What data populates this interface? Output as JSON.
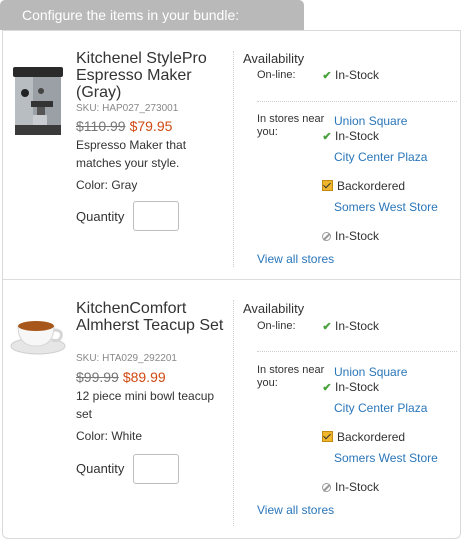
{
  "header": {
    "title": "Configure the items in your bundle:"
  },
  "labels": {
    "quantity": "Quantity",
    "availability": "Availability",
    "online": "On-line:",
    "in_stores": "In stores near you:",
    "view_all": "View all stores"
  },
  "items": [
    {
      "title": "Kitchenel StylePro Espresso Maker (Gray)",
      "sku": "SKU: HAP027_273001",
      "price_old": "$110.99",
      "price_new": "$79.95",
      "desc": "Espresso Maker that matches your style.",
      "color": "Color: Gray",
      "image_icon": "espresso-maker-image",
      "online_status": "In-Stock",
      "stores": [
        {
          "name": "Union Square",
          "status": "In-Stock",
          "icon": "check-icon"
        },
        {
          "name": "City Center Plaza",
          "status": "Backordered",
          "icon": "backorder-icon"
        },
        {
          "name": "Somers West Store",
          "status": "In-Stock",
          "icon": "unavailable-icon"
        }
      ]
    },
    {
      "title": "KitchenComfort Almherst Teacup Set",
      "sku": "SKU: HTA029_292201",
      "price_old": "$99.99",
      "price_new": "$89.99",
      "desc": "12 piece mini bowl teacup set",
      "color": "Color: White",
      "image_icon": "teacup-image",
      "online_status": "In-Stock",
      "stores": [
        {
          "name": "Union Square",
          "status": "In-Stock",
          "icon": "check-icon"
        },
        {
          "name": "City Center Plaza",
          "status": "Backordered",
          "icon": "backorder-icon"
        },
        {
          "name": "Somers West Store",
          "status": "In-Stock",
          "icon": "unavailable-icon"
        }
      ]
    }
  ],
  "colors": {
    "link": "#2a76b9",
    "sale_price": "#d04a12",
    "header_bg": "#b9b9b9",
    "in_stock_check": "#4aa23d"
  }
}
